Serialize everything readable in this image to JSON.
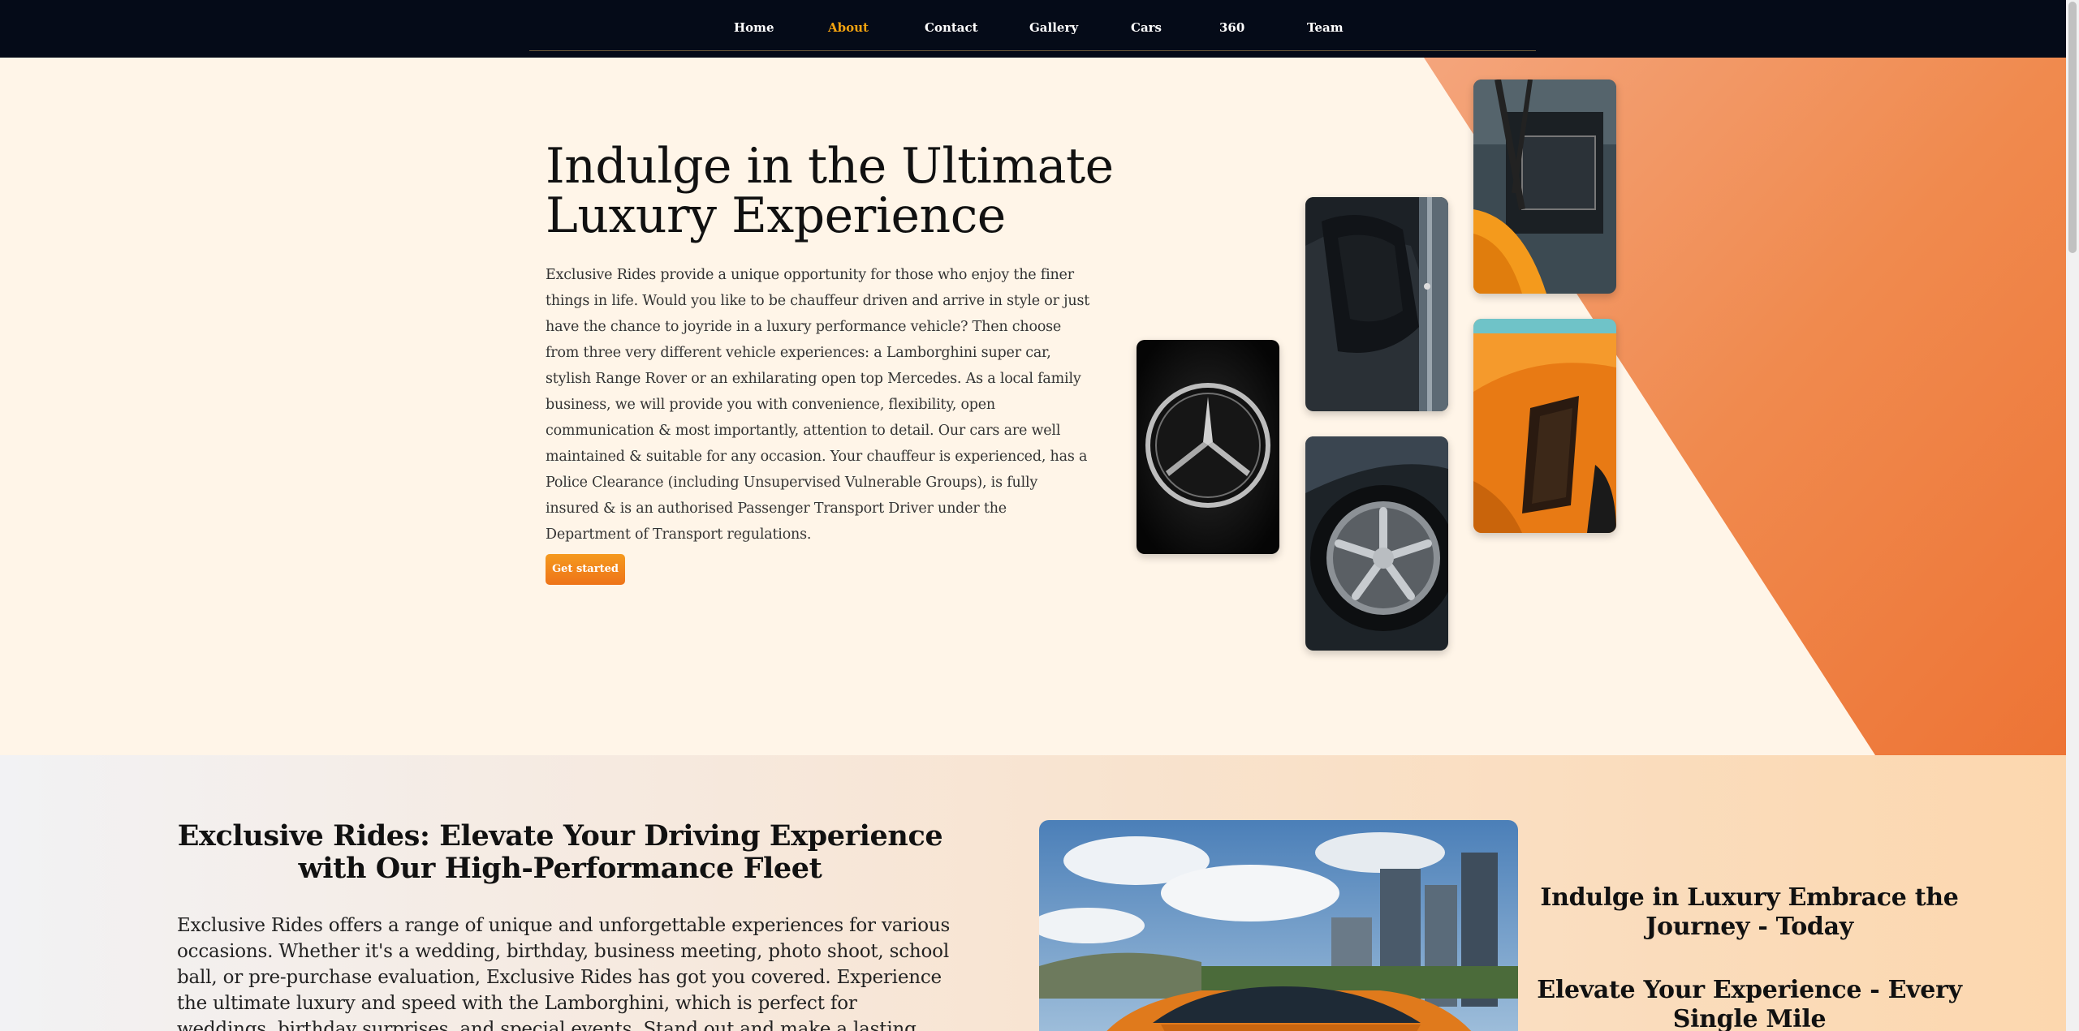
{
  "nav": {
    "items": [
      {
        "label": "Home"
      },
      {
        "label": "About"
      },
      {
        "label": "Contact"
      },
      {
        "label": "Gallery"
      },
      {
        "label": "Cars"
      },
      {
        "label": "360"
      },
      {
        "label": "Team"
      }
    ],
    "active": "About"
  },
  "hero": {
    "title": "Indulge in the Ultimate Luxury Experience",
    "body": "Exclusive Rides provide a unique opportunity for those who enjoy the finer things in life. Would you like to be chauffeur driven and arrive in style or just have the chance to joyride in a luxury performance vehicle? Then choose from three very different vehicle experiences: a Lamborghini super car, stylish Range Rover or an exhilarating open top Mercedes. As a local family business, we will provide you with convenience, flexibility, open communication & most importantly, attention to detail. Our cars are well maintained & suitable for any occasion. Your chauffeur is experienced, has a Police Clearance (including Unsupervised Vulnerable Groups), is fully insured & is an authorised Passenger Transport Driver under the Department of Transport regulations.",
    "cta_label": "Get started"
  },
  "section2": {
    "title": "Exclusive Rides: Elevate Your Driving Experience with Our High-Performance Fleet",
    "body": "Exclusive Rides offers a range of unique and unforgettable experiences for various occasions. Whether it's a wedding, birthday, business meeting, photo shoot, school ball, or pre-purchase evaluation, Exclusive Rides has got you covered. Experience the ultimate luxury and speed with the Lamborghini, which is perfect for weddings, birthday surprises, and special events. Stand out and make a lasting impression with",
    "tagline_1": "Indulge in Luxury Embrace the Journey - Today",
    "tagline_2": "Elevate Your Experience - Every Single Mile"
  },
  "colors": {
    "nav_bg": "#050b18",
    "accent": "#f5a40f",
    "orange": "#ef7b3c",
    "hero_bg": "#fff5e8"
  }
}
